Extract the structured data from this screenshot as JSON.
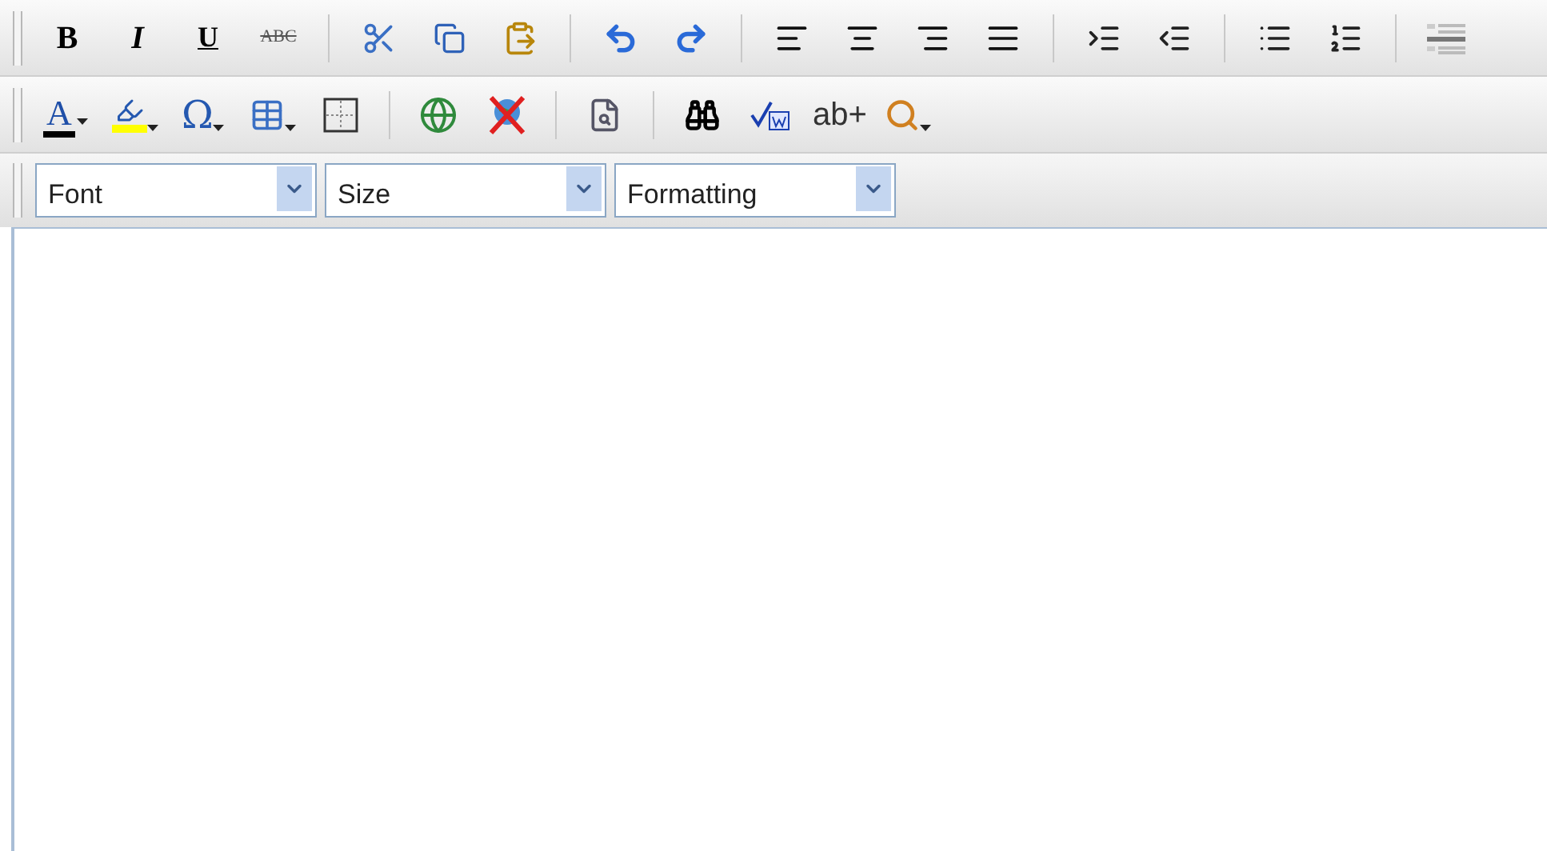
{
  "toolbar_1": {
    "format_buttons": [
      {
        "label": "B",
        "kind": "bold"
      },
      {
        "label": "I",
        "kind": "italic"
      },
      {
        "label": "U",
        "kind": "underline"
      },
      {
        "label": "ABC",
        "kind": "strike"
      }
    ]
  },
  "toolbar_2": {
    "font_color_button": {
      "label": "A"
    },
    "special_char_button": {
      "label": "Ω"
    },
    "replace_button": {
      "label": "ab+"
    }
  },
  "toolbar_3": {
    "dropdowns": [
      {
        "label": "Font"
      },
      {
        "label": "Size"
      },
      {
        "label": "Formatting"
      }
    ]
  }
}
